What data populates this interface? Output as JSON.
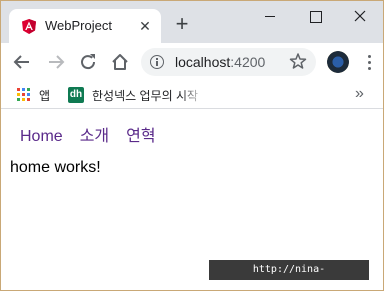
{
  "browser": {
    "tab": {
      "title": "WebProject",
      "close_glyph": "✕",
      "favicon": "angular-logo-icon",
      "favicon_color": "#dd0031"
    },
    "new_tab_glyph": "+",
    "window_controls": {
      "close_glyph": "✕"
    },
    "address": {
      "host": "localhost",
      "port": ":4200"
    },
    "bookmarks": {
      "apps_label": "앱",
      "site_icon_text": "dh",
      "site_label": "한성넥스 업무의 시작",
      "more_glyph": "»"
    }
  },
  "page": {
    "nav": [
      {
        "label": "Home"
      },
      {
        "label": "소개"
      },
      {
        "label": "연혁"
      }
    ],
    "body_text": "home works!",
    "link_color": "#5a2a8a"
  },
  "watermark": "http://nina-life.tistory.com"
}
